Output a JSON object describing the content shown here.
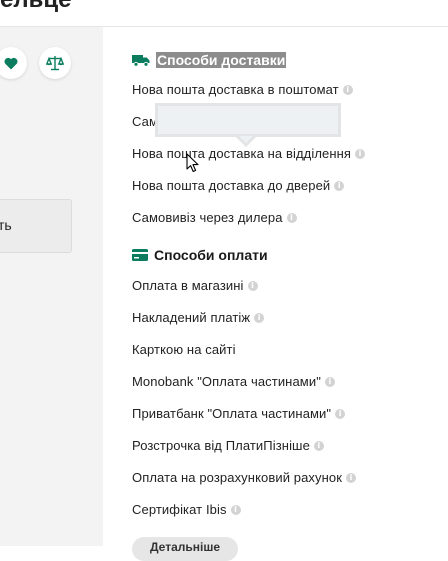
{
  "header": {
    "title_fragment": "ельце"
  },
  "left": {
    "wishlist_icon": "heart-icon",
    "compare_icon": "scales-icon",
    "button_label": "ть"
  },
  "delivery": {
    "title": "Способи доставки",
    "icon": "truck-icon",
    "items": [
      {
        "label": "Нова пошта доставка в поштомат",
        "info": true
      },
      {
        "label": "Сам",
        "info": false
      },
      {
        "label": "Нова пошта доставка на відділення",
        "info": true
      },
      {
        "label": "Нова пошта доставка до дверей",
        "info": true
      },
      {
        "label": "Самовивіз через дилера",
        "info": true
      }
    ]
  },
  "payment": {
    "title": "Способи оплати",
    "icon": "credit-card-icon",
    "items": [
      {
        "label": "Оплата в магазині",
        "info": true
      },
      {
        "label": "Накладений платіж",
        "info": true
      },
      {
        "label": "Карткою на сайті",
        "info": false
      },
      {
        "label": "Monobank \"Оплата частинами\"",
        "info": true
      },
      {
        "label": "Приватбанк \"Оплата частинами\"",
        "info": true
      },
      {
        "label": "Розстрочка від ПлатиПізніше",
        "info": true
      },
      {
        "label": "Оплата на розрахунковий рахунок",
        "info": true
      },
      {
        "label": "Сертифікат Ibis",
        "info": true
      }
    ]
  },
  "more_button": {
    "label": "Детальніше"
  },
  "colors": {
    "accent": "#0b7d5e",
    "selection": "#8c8c8c"
  }
}
